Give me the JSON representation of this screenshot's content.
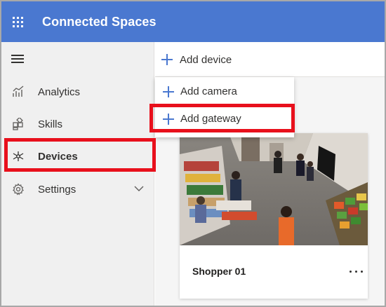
{
  "header": {
    "app_title": "Connected Spaces",
    "waffle_icon": "app-launcher-icon",
    "color": "#4a78d0"
  },
  "sidebar": {
    "items": [
      {
        "label": "Analytics",
        "icon": "analytics-icon"
      },
      {
        "label": "Skills",
        "icon": "skills-icon"
      },
      {
        "label": "Devices",
        "icon": "devices-icon",
        "active": true
      },
      {
        "label": "Settings",
        "icon": "settings-icon",
        "expandable": true
      }
    ]
  },
  "command_bar": {
    "add_device": "Add device"
  },
  "menu": {
    "add_camera": "Add camera",
    "add_gateway": "Add gateway"
  },
  "device_card": {
    "title": "Shopper 01"
  },
  "highlight_color": "#e8101c"
}
